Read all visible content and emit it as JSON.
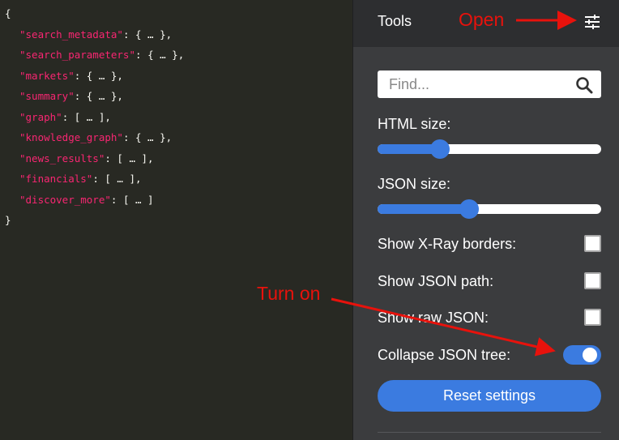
{
  "json_viewer": {
    "open_brace": "{",
    "close_brace": "}",
    "entries": [
      {
        "key": "\"search_metadata\"",
        "value": "{ … },"
      },
      {
        "key": "\"search_parameters\"",
        "value": "{ … },"
      },
      {
        "key": "\"markets\"",
        "value": "{ … },"
      },
      {
        "key": "\"summary\"",
        "value": "{ … },"
      },
      {
        "key": "\"graph\"",
        "value": "[ … ],"
      },
      {
        "key": "\"knowledge_graph\"",
        "value": "{ … },"
      },
      {
        "key": "\"news_results\"",
        "value": "[ … ],"
      },
      {
        "key": "\"financials\"",
        "value": "[ … ],"
      },
      {
        "key": "\"discover_more\"",
        "value": "[ … ]"
      }
    ]
  },
  "tools": {
    "title": "Tools",
    "settings_icon": "sliders-icon",
    "find": {
      "placeholder": "Find...",
      "value": "",
      "icon": "search-icon"
    },
    "html_size": {
      "label": "HTML size:",
      "value": 0.28
    },
    "json_size": {
      "label": "JSON size:",
      "value": 0.41
    },
    "options": [
      {
        "label": "Show X-Ray borders:",
        "checked": false
      },
      {
        "label": "Show JSON path:",
        "checked": false
      },
      {
        "label": "Show raw JSON:",
        "checked": false
      }
    ],
    "collapse": {
      "label": "Collapse JSON tree:",
      "on": true
    },
    "reset_label": "Reset settings"
  },
  "annotations": {
    "open": "Open",
    "turn_on": "Turn on",
    "color": "#e8120c"
  },
  "colors": {
    "accent": "#3b7be0",
    "json_key": "#f92672",
    "editor_bg": "#282923",
    "panel_bg": "#3b3c3e",
    "header_bg": "#2d2e30"
  }
}
